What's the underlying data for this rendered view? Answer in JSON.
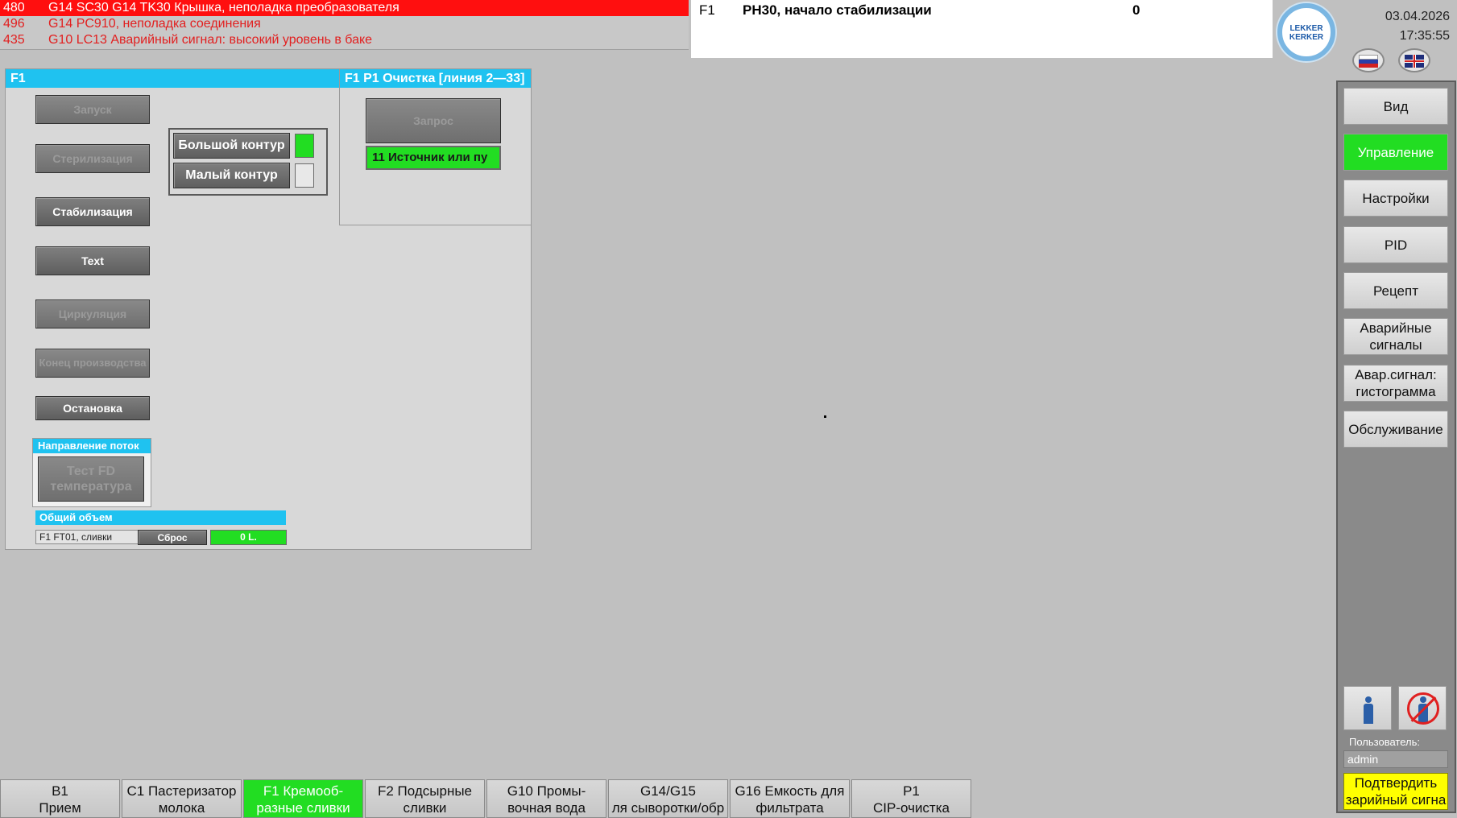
{
  "alarms": [
    {
      "num": "480",
      "text": "G14 SC30 G14 TK30 Крышка, неполадка преобразователя",
      "active": true
    },
    {
      "num": "496",
      "text": "G14 PC910, неполадка соединения",
      "active": false
    },
    {
      "num": "435",
      "text": "G10 LC13 Аварийный сигнал: высокий уровень в баке",
      "active": false
    }
  ],
  "status": {
    "unit": "F1",
    "message": "PH30, начало стабилизации",
    "value": "0"
  },
  "logo": {
    "line1": "LEKKER",
    "line2": "KERKER"
  },
  "datetime": {
    "date": "03.04.2026",
    "time": "17:35:55"
  },
  "panel": {
    "title": "F1",
    "buttons": {
      "start": "Запуск",
      "sterilization": "Стерилизация",
      "stabilization": "Стабилизация",
      "text": "Text",
      "circulation": "Циркуляция",
      "end_production": "Конец производства",
      "stop": "Остановка"
    },
    "contour": {
      "big": "Большой контур",
      "small": "Малый контур"
    },
    "flow": {
      "title": "Направление поток",
      "test_button": "Тест FD температура"
    },
    "volume": {
      "title": "Общий объем",
      "name": "F1 FT01, сливки",
      "reset": "Сброс",
      "value": "0 L."
    }
  },
  "subpanel": {
    "title": "F1 P1 Очистка [линия 2—33]",
    "request": "Запрос",
    "source": "11 Источник или пу"
  },
  "nav": {
    "items": [
      {
        "label": "Вид",
        "active": false
      },
      {
        "label": "Управление",
        "active": true
      },
      {
        "label": "Настройки",
        "active": false
      },
      {
        "label": "PID",
        "active": false
      },
      {
        "label": "Рецепт",
        "active": false
      },
      {
        "label": "Аварийные сигналы",
        "active": false
      },
      {
        "label": "Авар.сигнал: гистограмма",
        "active": false
      },
      {
        "label": "Обслуживание",
        "active": false
      }
    ],
    "user_label": "Пользователь:",
    "user": "admin",
    "ack_line1": "Подтвердить",
    "ack_line2": "зарийный сигна"
  },
  "tabs": [
    {
      "line1": "B1",
      "line2": "Прием",
      "active": false
    },
    {
      "line1": "C1 Пастеризатор",
      "line2": "молока",
      "active": false
    },
    {
      "line1": "F1 Кремооб-",
      "line2": "разные сливки",
      "active": true
    },
    {
      "line1": "F2 Подсырные",
      "line2": "сливки",
      "active": false
    },
    {
      "line1": "G10 Промы-",
      "line2": "вочная вода",
      "active": false
    },
    {
      "line1": "G14/G15",
      "line2": "ля сыворотки/обр",
      "active": false
    },
    {
      "line1": "G16 Емкость для",
      "line2": "фильтрата",
      "active": false
    },
    {
      "line1": "P1",
      "line2": "CIP-очистка",
      "active": false
    }
  ]
}
